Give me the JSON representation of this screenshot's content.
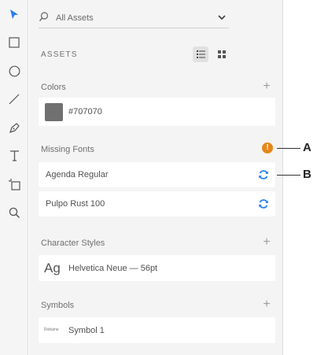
{
  "toolbar": {
    "tools": [
      {
        "icon": "select-arrow-icon",
        "active": true
      },
      {
        "icon": "rectangle-icon"
      },
      {
        "icon": "ellipse-icon"
      },
      {
        "icon": "line-icon"
      },
      {
        "icon": "pen-icon"
      },
      {
        "icon": "text-icon"
      },
      {
        "icon": "artboard-icon"
      },
      {
        "icon": "zoom-icon"
      }
    ],
    "accent": "#2680eb"
  },
  "search": {
    "placeholder": "All Assets"
  },
  "assets": {
    "title": "ASSETS"
  },
  "colors": {
    "label": "Colors",
    "items": [
      {
        "name": "#707070",
        "hex": "#707070"
      }
    ]
  },
  "missing_fonts": {
    "label": "Missing Fonts",
    "warning_color": "#e68619",
    "items": [
      {
        "name": "Agenda Regular"
      },
      {
        "name": "Pulpo Rust 100"
      }
    ]
  },
  "character_styles": {
    "label": "Character Styles",
    "items": [
      {
        "preview": "Ag",
        "name": "Helvetica Neue — 56pt"
      }
    ]
  },
  "symbols": {
    "label": "Symbols",
    "items": [
      {
        "thumb": "Robaine",
        "name": "Symbol 1"
      }
    ]
  },
  "callouts": {
    "a": "A",
    "b": "B"
  }
}
